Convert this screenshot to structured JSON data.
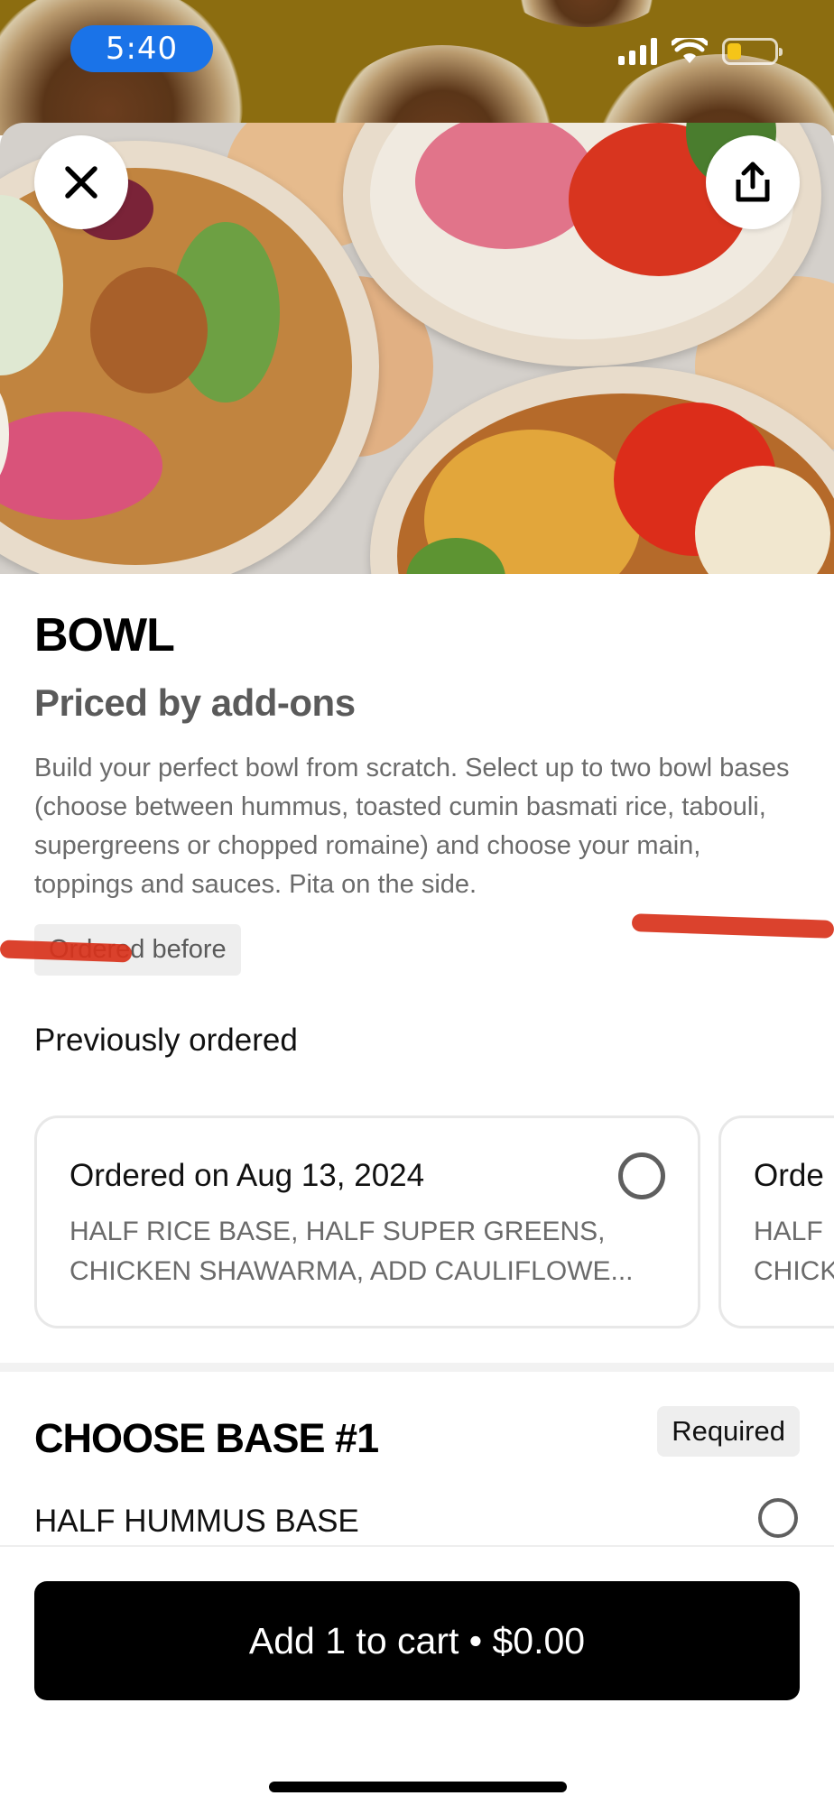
{
  "status_bar": {
    "time": "5:40",
    "battery_color": "#f5c518",
    "battery_level": 0.3
  },
  "hero": {
    "close_icon": "close-icon",
    "share_icon": "share-icon"
  },
  "item": {
    "title": "BOWL",
    "price_note": "Priced by add-ons",
    "description": "Build your perfect bowl from scratch.  Select up to two bowl bases (choose between hummus, toasted cumin basmati rice, tabouli, supergreens or chopped romaine) and choose your main, toppings and sauces. Pita on the side.",
    "ordered_before": "Ordered before"
  },
  "previous": {
    "label": "Previously ordered",
    "orders": [
      {
        "title": "Ordered on Aug 13, 2024",
        "line1": "HALF RICE BASE, HALF SUPER GREENS,",
        "line2": "CHICKEN SHAWARMA, ADD CAULIFLOWE..."
      },
      {
        "title": "Orde",
        "line1": "HALF",
        "line2": "CHICK"
      }
    ]
  },
  "section": {
    "title": "CHOOSE BASE #1",
    "required": "Required",
    "options": [
      {
        "label": "HALF HUMMUS BASE"
      }
    ]
  },
  "cart": {
    "button_label": "Add 1 to cart • $0.00"
  }
}
